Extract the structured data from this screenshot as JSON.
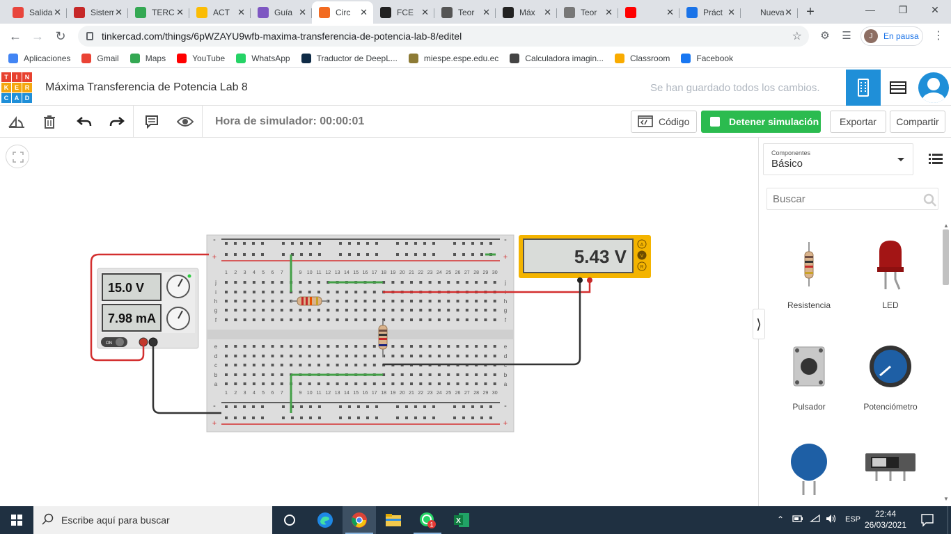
{
  "browser": {
    "tabs": [
      {
        "label": "Salida",
        "favicon_color": "#e8453c",
        "active": false
      },
      {
        "label": "Sistema",
        "favicon_color": "#c62828",
        "active": false
      },
      {
        "label": "TERC",
        "favicon_color": "#34a853",
        "active": false
      },
      {
        "label": "ACT",
        "favicon_color": "#fbbc04",
        "active": false
      },
      {
        "label": "Guía",
        "favicon_color": "#7e57c2",
        "active": false
      },
      {
        "label": "Circ",
        "favicon_color": "#f26b21",
        "active": true
      },
      {
        "label": "FCE",
        "favicon_color": "#222222",
        "active": false
      },
      {
        "label": "Teor",
        "favicon_color": "#555555",
        "active": false
      },
      {
        "label": "Máx",
        "favicon_color": "#222222",
        "active": false
      },
      {
        "label": "Teor",
        "favicon_color": "#777777",
        "active": false
      },
      {
        "label": "",
        "favicon_color": "#ff0000",
        "active": false
      },
      {
        "label": "Práct",
        "favicon_color": "#1a73e8",
        "active": false
      },
      {
        "label": "Nueva pe",
        "favicon_color": "#dee1e6",
        "active": false
      }
    ],
    "url": "tinkercad.com/things/6pWZAYU9wfb-maxima-transferencia-de-potencia-lab-8/editel",
    "profile_label": "En pausa",
    "profile_initial": "J",
    "bookmarks": [
      {
        "label": "Aplicaciones",
        "color": "#4285f4"
      },
      {
        "label": "Gmail",
        "color": "#ea4335"
      },
      {
        "label": "Maps",
        "color": "#34a853"
      },
      {
        "label": "YouTube",
        "color": "#ff0000"
      },
      {
        "label": "WhatsApp",
        "color": "#25d366"
      },
      {
        "label": "Traductor de DeepL...",
        "color": "#0f2b46"
      },
      {
        "label": "miespe.espe.edu.ec",
        "color": "#8d7b35"
      },
      {
        "label": "Calculadora imagin...",
        "color": "#444444"
      },
      {
        "label": "Classroom",
        "color": "#f9ab00"
      },
      {
        "label": "Facebook",
        "color": "#1877f2"
      }
    ]
  },
  "tinkercad": {
    "title": "Máxima Transferencia de Potencia Lab 8",
    "save_status": "Se han guardado todos los cambios.",
    "logo_letters": [
      "T",
      "I",
      "N",
      "K",
      "E",
      "R",
      "C",
      "A",
      "D"
    ],
    "sim_time": "Hora de simulador: 00:00:01",
    "code_label": "Código",
    "stop_label": "Detener simulación",
    "export_label": "Exportar",
    "share_label": "Compartir"
  },
  "circuit": {
    "power_supply": {
      "voltage": "15.0 V",
      "current": "7.98 mA",
      "switch_label": "ON"
    },
    "multimeter": {
      "reading": "5.43 V",
      "modes": [
        "A",
        "V",
        "R"
      ]
    },
    "breadboard": {
      "columns": [
        "1",
        "2",
        "3",
        "4",
        "5",
        "6",
        "7",
        "8",
        "9",
        "10",
        "11",
        "12",
        "13",
        "14",
        "15",
        "16",
        "17",
        "18",
        "19",
        "20",
        "21",
        "22",
        "23",
        "24",
        "25",
        "26",
        "27",
        "28",
        "29",
        "30"
      ],
      "rows_top": [
        "j",
        "i",
        "h",
        "g",
        "f"
      ],
      "rows_bottom": [
        "e",
        "d",
        "c",
        "b",
        "a"
      ]
    }
  },
  "panel": {
    "category_label": "Componentes",
    "category_value": "Básico",
    "search_placeholder": "Buscar",
    "components": [
      "Resistencia",
      "LED",
      "Pulsador",
      "Potenciómetro"
    ]
  },
  "taskbar": {
    "search_placeholder": "Escribe aquí para buscar",
    "language": "ESP",
    "time": "22:44",
    "date": "26/03/2021",
    "whatsapp_badge": "1"
  }
}
